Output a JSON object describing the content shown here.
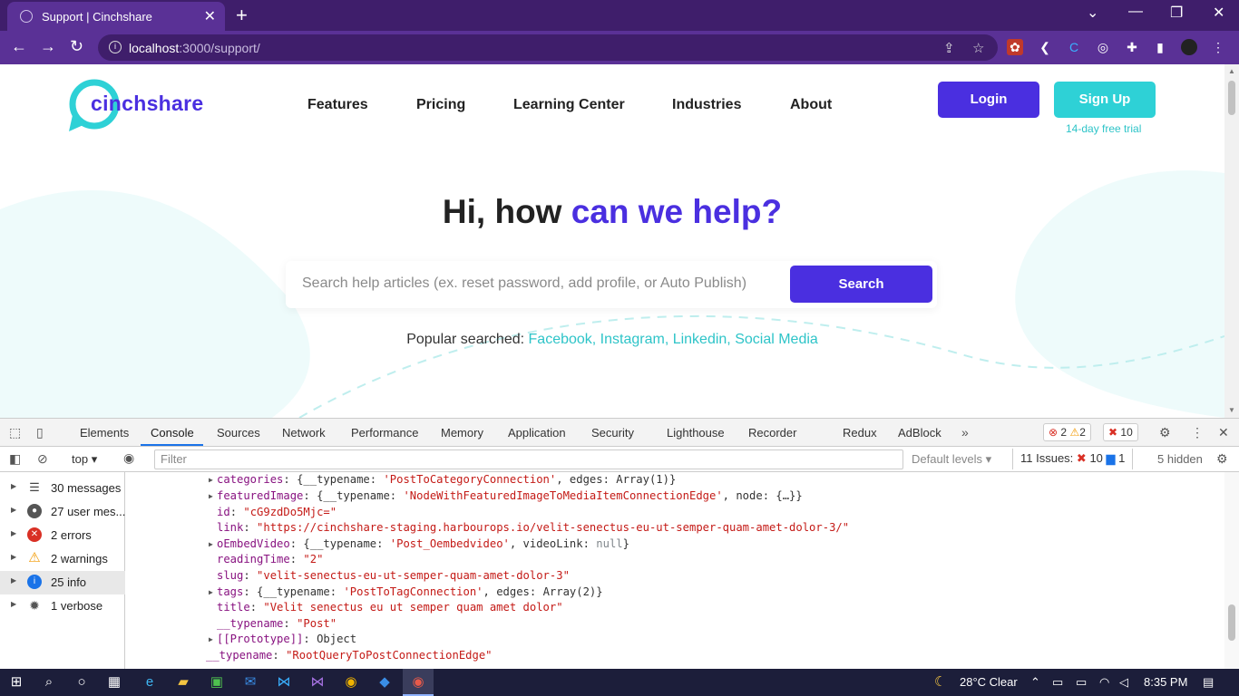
{
  "browser": {
    "tab_title": "Support | Cinchshare",
    "url_host": "localhost",
    "url_path": ":3000/support/"
  },
  "site": {
    "logo_text": "cinchshare",
    "nav": [
      "Features",
      "Pricing",
      "Learning Center",
      "Industries",
      "About"
    ],
    "login_label": "Login",
    "signup_label": "Sign Up",
    "trial_text": "14-day free trial",
    "hero_title_plain": "Hi, how ",
    "hero_title_accent": "can we help?",
    "search_placeholder": "Search help articles (ex. reset password, add profile, or Auto Publish)",
    "search_button": "Search",
    "popular_label": "Popular searched:",
    "popular_links": "Facebook, Instagram, Linkedin, Social Media",
    "colors": {
      "primary": "#4a2fe0",
      "teal": "#2ec4c8",
      "browser": "#5a3196"
    }
  },
  "devtools": {
    "tabs": [
      "Elements",
      "Console",
      "Sources",
      "Network",
      "Performance",
      "Memory",
      "Application",
      "Security",
      "Lighthouse",
      "Recorder",
      "Redux",
      "AdBlock"
    ],
    "active_tab": "Console",
    "badge_errors": "2",
    "badge_warnings": "2",
    "badge_issues": "10",
    "context": "top",
    "filter_placeholder": "Filter",
    "levels": "Default levels",
    "issues_label": "11 Issues:",
    "issues_err": "10",
    "issues_info": "1",
    "hidden": "5 hidden",
    "sidebar": [
      {
        "label": "30 messages",
        "icon": "list-icon"
      },
      {
        "label": "27 user mes...",
        "icon": "user-icon"
      },
      {
        "label": "2 errors",
        "icon": "error-icon"
      },
      {
        "label": "2 warnings",
        "icon": "warning-icon"
      },
      {
        "label": "25 info",
        "icon": "info-icon"
      },
      {
        "label": "1 verbose",
        "icon": "bug-icon"
      }
    ],
    "console_lines": {
      "l1_key": "categories",
      "l1_a": "{__typename: ",
      "l1_s": "'PostToCategoryConnection'",
      "l1_b": ", edges: Array(1)}",
      "l2_key": "featuredImage",
      "l2_a": "{__typename: ",
      "l2_s": "'NodeWithFeaturedImageToMediaItemConnectionEdge'",
      "l2_b": ", node: {…}}",
      "l3_key": "id",
      "l3_s": "\"cG9zdDo5Mjc=\"",
      "l4_key": "link",
      "l4_s": "\"https://cinchshare-staging.harbourops.io/velit-senectus-eu-ut-semper-quam-amet-dolor-3/\"",
      "l5_key": "oEmbedVideo",
      "l5_a": "{__typename: ",
      "l5_s": "'Post_Oembedvideo'",
      "l5_b": ", videoLink: ",
      "l5_n": "null",
      "l5_c": "}",
      "l6_key": "readingTime",
      "l6_s": "\"2\"",
      "l7_key": "slug",
      "l7_s": "\"velit-senectus-eu-ut-semper-quam-amet-dolor-3\"",
      "l8_key": "tags",
      "l8_a": "{__typename: ",
      "l8_s": "'PostToTagConnection'",
      "l8_b": ", edges: Array(2)}",
      "l9_key": "title",
      "l9_s": "\"Velit senectus eu ut semper quam amet dolor\"",
      "l10_key": "__typename",
      "l10_s": "\"Post\"",
      "l11_key": "[[Prototype]]",
      "l11_v": "Object",
      "l12_key": "__typename",
      "l12_s": "\"RootQueryToPostConnectionEdge\""
    }
  },
  "taskbar": {
    "weather": "28°C  Clear",
    "time": "8:35 PM"
  }
}
